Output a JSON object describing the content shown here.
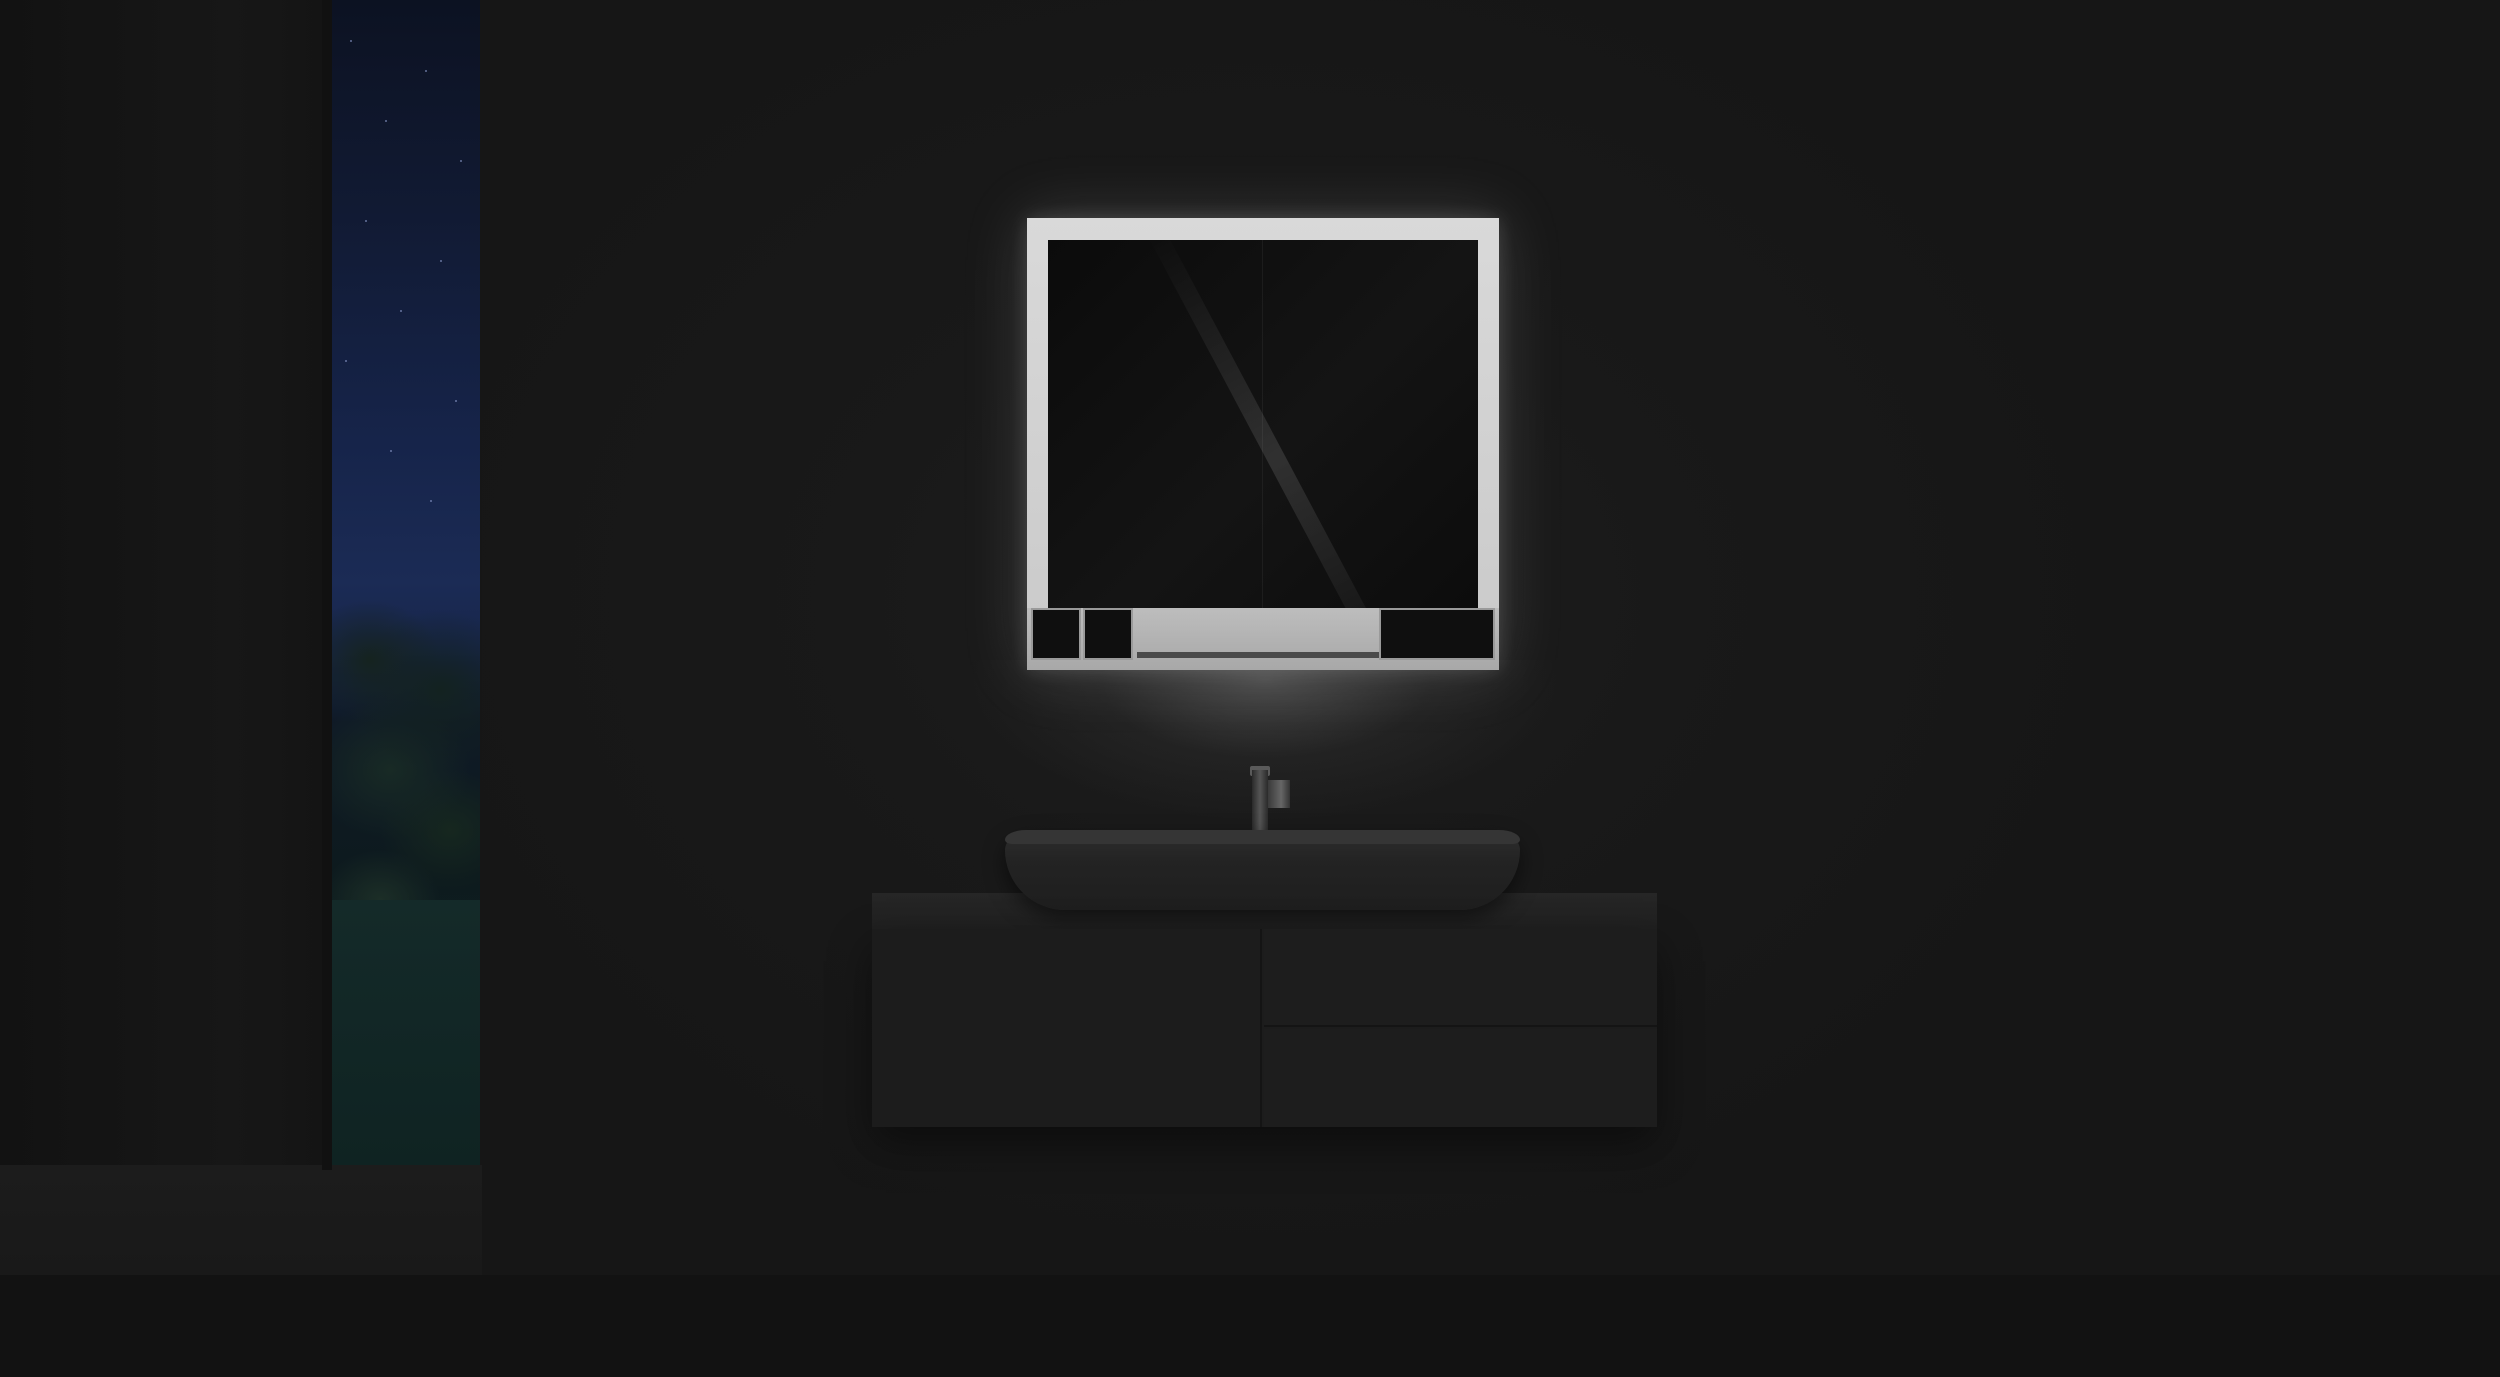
{
  "scene": {
    "description_visible_text": "",
    "colors": {
      "wall": "#1a1a1a",
      "night_sky": "#16244a",
      "lawn": "#0f2322",
      "mirror_light": "#d9d9d9",
      "cabinet": "#1c1c1c"
    },
    "icons": [
      "mirror-cabinet-icon",
      "faucet-icon",
      "basin-icon"
    ]
  }
}
